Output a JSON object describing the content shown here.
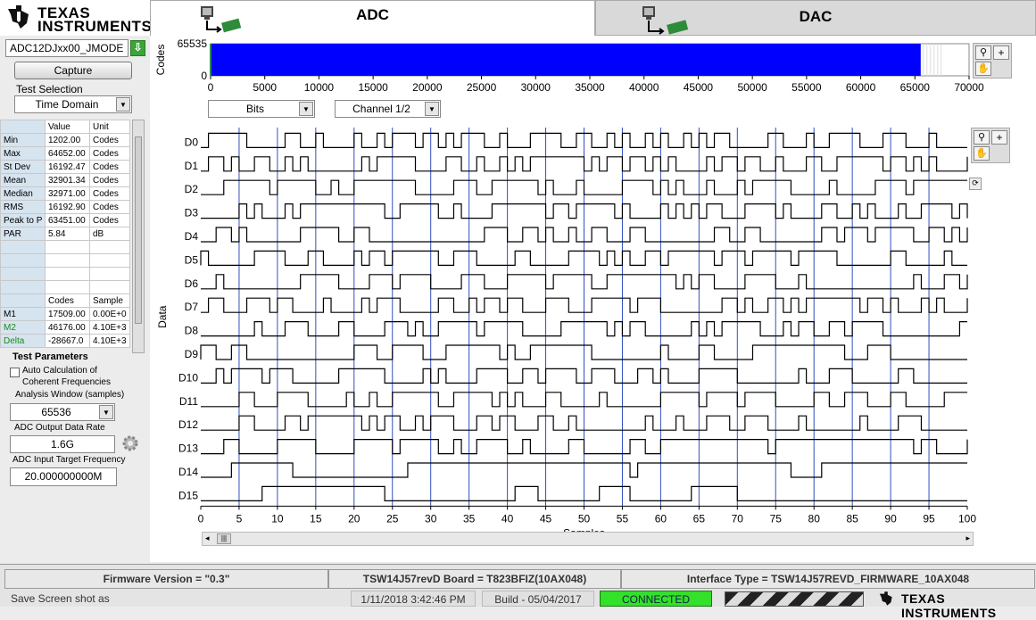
{
  "brand": {
    "line1": "TEXAS",
    "line2": "INSTRUMENTS",
    "footer": "TEXAS INSTRUMENTS"
  },
  "tabs": [
    {
      "label": "ADC"
    },
    {
      "label": "DAC"
    }
  ],
  "device_select": {
    "value": "ADC12DJxx00_JMODE"
  },
  "capture_label": "Capture",
  "test_selection": {
    "label": "Test Selection",
    "value": "Time Domain"
  },
  "stats": {
    "headers": [
      "Value",
      "Unit"
    ],
    "rows": [
      {
        "name": "Min",
        "value": "1202.00",
        "unit": "Codes"
      },
      {
        "name": "Max",
        "value": "64652.00",
        "unit": "Codes"
      },
      {
        "name": "St Dev",
        "value": "16192.47",
        "unit": "Codes"
      },
      {
        "name": "Mean",
        "value": "32901.34",
        "unit": "Codes"
      },
      {
        "name": "Median",
        "value": "32971.00",
        "unit": "Codes"
      },
      {
        "name": "RMS",
        "value": "16192.90",
        "unit": "Codes"
      },
      {
        "name": "Peak to P",
        "value": "63451.00",
        "unit": "Codes"
      },
      {
        "name": "PAR",
        "value": "5.84",
        "unit": "dB"
      }
    ],
    "marker_headers": [
      "Codes",
      "Sample"
    ],
    "markers": [
      {
        "name": "M1",
        "codes": "17509.00",
        "sample": "0.00E+0"
      },
      {
        "name": "M2",
        "codes": "46176.00",
        "sample": "4.10E+3"
      },
      {
        "name": "Delta",
        "codes": "-28667.0",
        "sample": "4.10E+3"
      }
    ]
  },
  "test_params": {
    "title": "Test Parameters",
    "auto_calc_line1": "Auto Calculation of",
    "auto_calc_line2": "Coherent Frequencies",
    "analysis_window_label": "Analysis Window (samples)",
    "analysis_window_value": "65536",
    "output_rate_label": "ADC Output Data Rate",
    "output_rate_value": "1.6G",
    "input_freq_label": "ADC Input Target Frequency",
    "input_freq_value": "20.000000000M"
  },
  "overview": {
    "ylabel": "Codes",
    "ymax_label": "65535",
    "ymin_label": "0",
    "xticks": [
      "0",
      "5000",
      "10000",
      "15000",
      "20000",
      "25000",
      "30000",
      "35000",
      "40000",
      "45000",
      "50000",
      "55000",
      "60000",
      "65000",
      "70000"
    ],
    "fill_end": 65536,
    "xmax": 70000
  },
  "display_select": {
    "value": "Bits"
  },
  "channel_select": {
    "value": "Channel 1/2"
  },
  "chart_data": {
    "type": "line",
    "xlabel": "Samples",
    "ylabel": "Data",
    "xlim": [
      0,
      100
    ],
    "xticks": [
      "0",
      "5",
      "10",
      "15",
      "20",
      "25",
      "30",
      "35",
      "40",
      "45",
      "50",
      "55",
      "60",
      "65",
      "70",
      "75",
      "80",
      "85",
      "90",
      "95",
      "100"
    ],
    "bit_labels": [
      "D0",
      "D1",
      "D2",
      "D3",
      "D4",
      "D5",
      "D6",
      "D7",
      "D8",
      "D9",
      "D10",
      "D11",
      "D12",
      "D13",
      "D14",
      "D15"
    ],
    "marker_lines_x": [
      5,
      10,
      15,
      20,
      25,
      30,
      35,
      40,
      45,
      50,
      55,
      60,
      65,
      70,
      75,
      80,
      85,
      90,
      95
    ]
  },
  "status": {
    "firmware": "Firmware Version = \"0.3\"",
    "board": "TSW14J57revD Board = T823BFIZ(10AX048)",
    "interface": "Interface Type = TSW14J57REVD_FIRMWARE_10AX048",
    "screenshot": "Save Screen shot as",
    "datetime": "1/11/2018 3:42:46 PM",
    "build": "Build  - 05/04/2017",
    "connection": "CONNECTED"
  }
}
